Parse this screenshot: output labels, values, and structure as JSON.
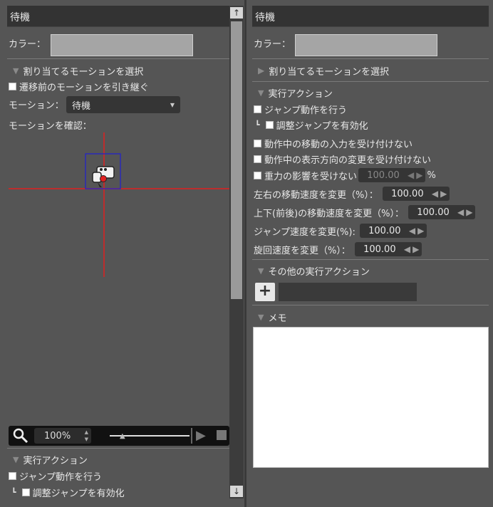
{
  "left": {
    "title": "待機",
    "color_label": "カラー：",
    "section_select_motion": "割り当てるモーションを選択",
    "inherit_motion_label": "遷移前のモーションを引き継ぐ",
    "motion_label": "モーション：",
    "motion_value": "待機",
    "confirm_motion_label": "モーションを確認：",
    "zoom_value": "100%",
    "section_actions": "実行アクション",
    "jump_label": "ジャンプ動作を行う",
    "adjust_jump_label": "調整ジャンプを有効化",
    "scroll_up": "↑",
    "scroll_down": "↓"
  },
  "right": {
    "title": "待機",
    "color_label": "カラー：",
    "section_select_motion": "割り当てるモーションを選択",
    "section_actions": "実行アクション",
    "jump_label": "ジャンプ動作を行う",
    "adjust_jump_label": "調整ジャンプを有効化",
    "ignore_move_input_label": "動作中の移動の入力を受け付けない",
    "ignore_direction_label": "動作中の表示方向の変更を受け付けない",
    "gravity_label": "重力の影響を受けない",
    "gravity_value": "100.00",
    "gravity_unit": "%",
    "lr_speed_label": "左右の移動速度を変更（%）：",
    "lr_speed_value": "100.00",
    "ud_speed_label": "上下(前後)の移動速度を変更（%）：",
    "ud_speed_value": "100.00",
    "jump_speed_label": "ジャンプ速度を変更(%):",
    "jump_speed_value": "100.00",
    "turn_speed_label": "旋回速度を変更（%）：",
    "turn_speed_value": "100.00",
    "section_other_actions": "その他の実行アクション",
    "add_button": "+",
    "section_memo": "メモ"
  },
  "colors": {
    "panel_bg": "#555555",
    "title_bg": "#333333",
    "swatch": "#a5a5a5",
    "crosshair": "#e02020",
    "frame": "#2020d0"
  }
}
